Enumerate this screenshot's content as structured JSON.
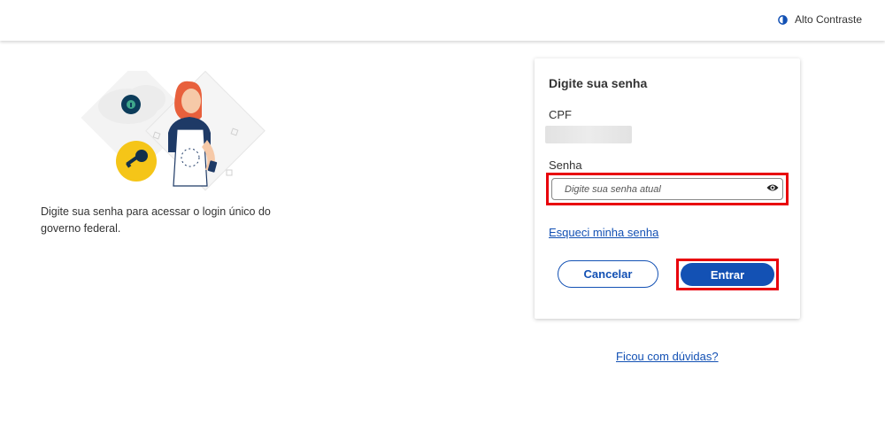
{
  "header": {
    "contrast_label": "Alto Contraste",
    "contrast_icon": "contrast-icon"
  },
  "left": {
    "illustration": "woman-with-key-illustration",
    "description": "Digite sua senha para acessar o login único do governo federal."
  },
  "card": {
    "title": "Digite sua senha",
    "cpf_label": "CPF",
    "cpf_value": "",
    "password_label": "Senha",
    "password_placeholder": "Digite sua senha atual",
    "password_value": "",
    "show_password_icon": "eye-icon",
    "forgot_link": "Esqueci minha senha",
    "cancel_label": "Cancelar",
    "enter_label": "Entrar"
  },
  "help_link": "Ficou com dúvidas?",
  "colors": {
    "primary": "#1351b4",
    "highlight": "#e8000b",
    "text": "#333333"
  }
}
